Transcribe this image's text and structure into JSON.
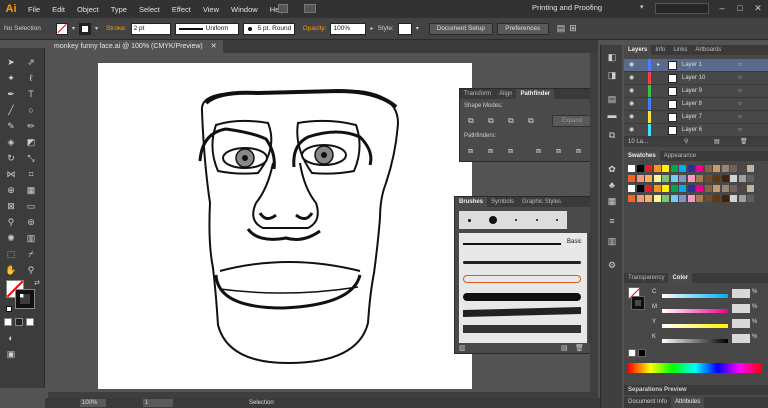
{
  "app": {
    "logo": "Ai",
    "workspace": "Printing and Proofing"
  },
  "menu": [
    "File",
    "Edit",
    "Object",
    "Type",
    "Select",
    "Effect",
    "View",
    "Window",
    "Help"
  ],
  "control_bar": {
    "selection_label": "No Selection",
    "stroke_label": "Stroke:",
    "stroke_value": "2 pt",
    "profile": "Uniform",
    "brush": "5 pt. Round",
    "opacity_label": "Opacity:",
    "opacity_value": "100%",
    "style_label": "Style:",
    "doc_setup": "Document Setup",
    "preferences": "Preferences"
  },
  "document": {
    "tab_title": "monkey funny face.ai @ 100% (CMYK/Preview)"
  },
  "pathfinder": {
    "tabs": [
      "Transform",
      "Align",
      "Pathfinder"
    ],
    "shape_modes": "Shape Modes:",
    "expand": "Expand",
    "pathfinders": "Pathfinders:"
  },
  "brushes": {
    "tabs": [
      "Brushes",
      "Symbols",
      "Graphic Styles"
    ],
    "basic": "Basic"
  },
  "layers": {
    "tabs": [
      "Layers",
      "Info",
      "Links",
      "Artboards"
    ],
    "items": [
      {
        "name": "Layer 1",
        "color": "#4a7cff"
      },
      {
        "name": "Layer 10",
        "color": "#ff4040"
      },
      {
        "name": "Layer 9",
        "color": "#40c040"
      },
      {
        "name": "Layer 8",
        "color": "#4080ff"
      },
      {
        "name": "Layer 7",
        "color": "#ffe040"
      },
      {
        "name": "Layer 6",
        "color": "#40e0ff"
      }
    ],
    "count": "10 La..."
  },
  "swatches": {
    "tabs": [
      "Swatches",
      "Appearance"
    ]
  },
  "color_panel": {
    "tabs": [
      "Transparency",
      "Color"
    ],
    "channels": [
      {
        "label": "C",
        "value": "%"
      },
      {
        "label": "M",
        "value": "%"
      },
      {
        "label": "Y",
        "value": "%"
      },
      {
        "label": "K",
        "value": "%"
      }
    ]
  },
  "separations": {
    "title": "Separations Preview"
  },
  "bottom_tabs": [
    "Document Info",
    "Attributes"
  ],
  "status": {
    "zoom": "100%",
    "page": "1",
    "tool": "Selection"
  }
}
